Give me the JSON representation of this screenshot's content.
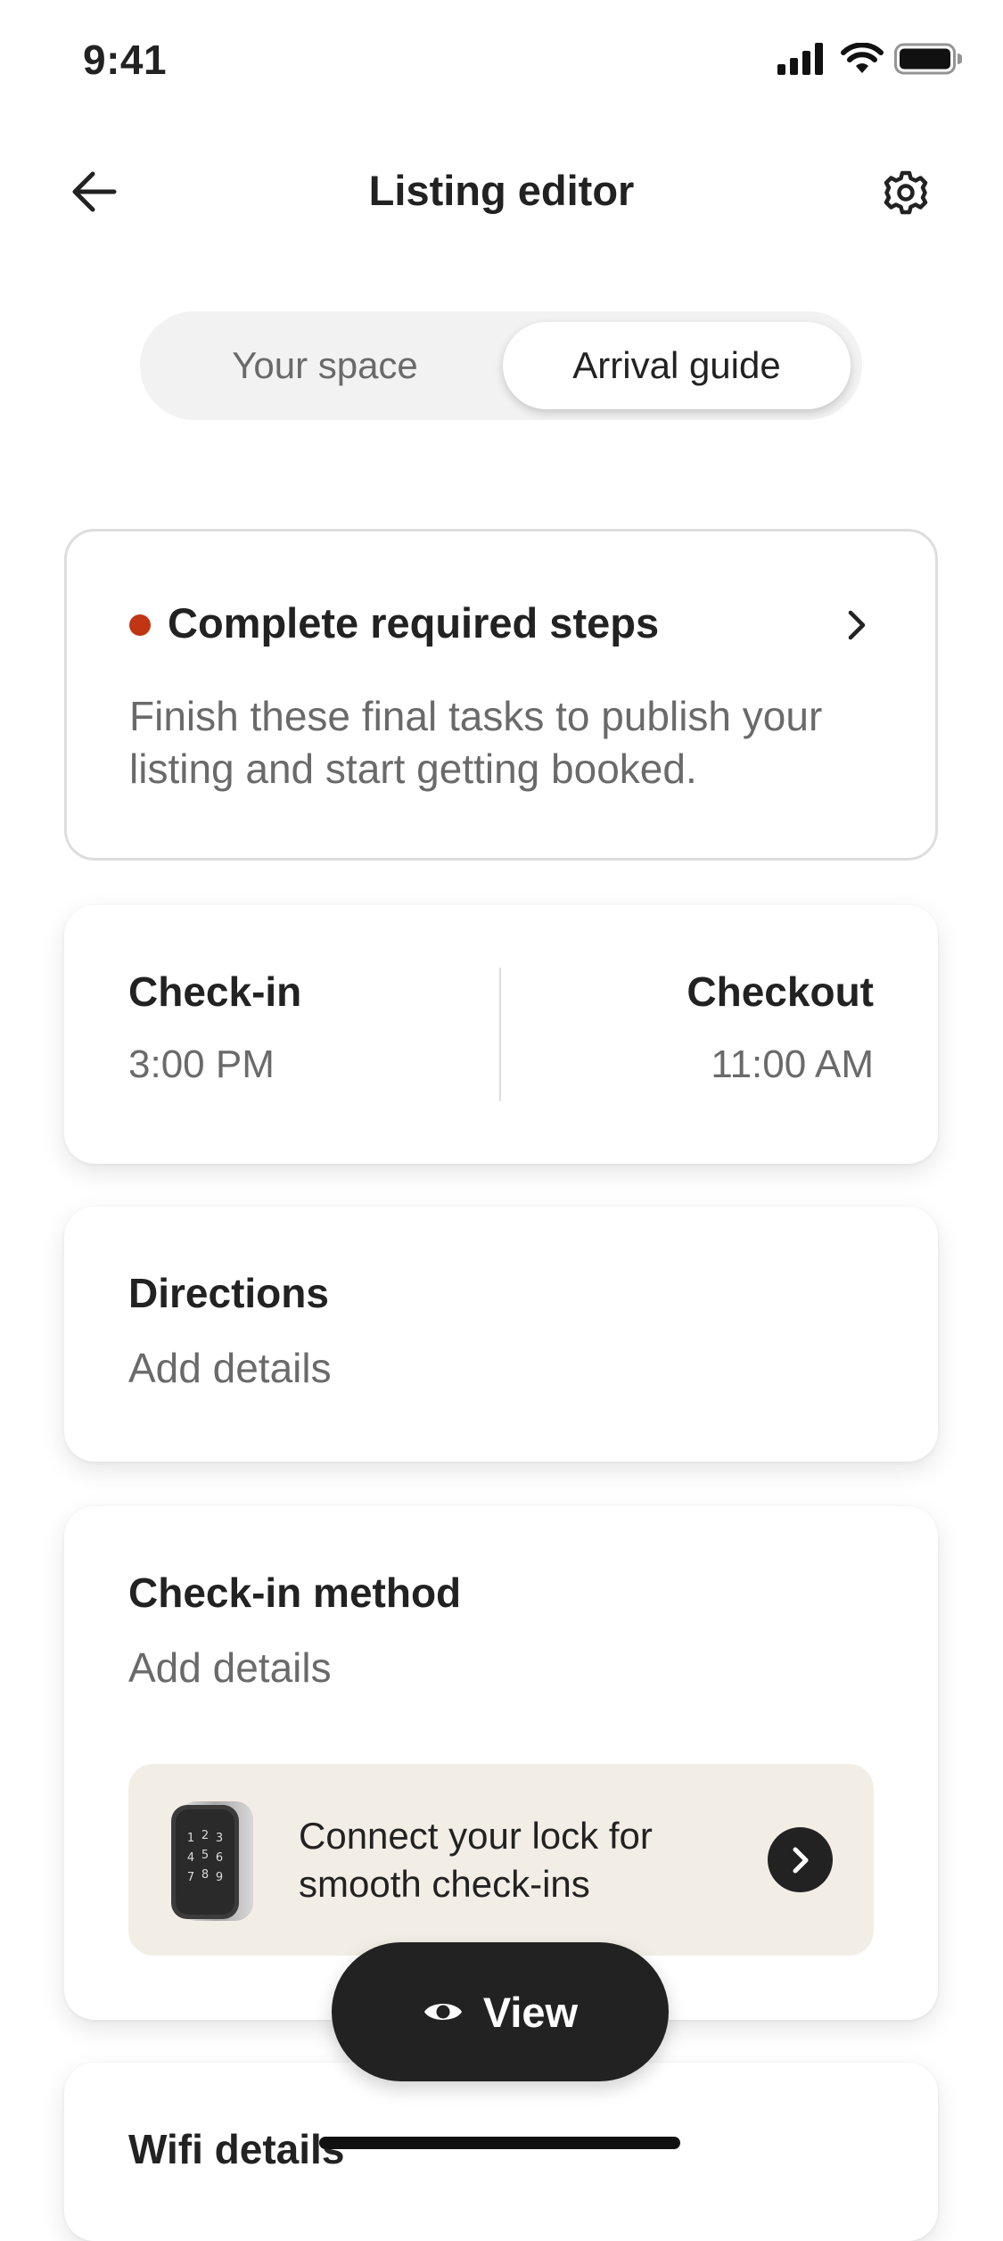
{
  "status_bar": {
    "time": "9:41"
  },
  "header": {
    "title": "Listing editor",
    "back_icon": "arrow-left-icon",
    "settings_icon": "gear-icon"
  },
  "tabs": [
    {
      "label": "Your space",
      "selected": false
    },
    {
      "label": "Arrival guide",
      "selected": true
    }
  ],
  "required_steps": {
    "title": "Complete required steps",
    "description": "Finish these final tasks to publish your listing and start getting booked.",
    "status_color": "#c13515"
  },
  "check_times": {
    "checkin_label": "Check-in",
    "checkin_value": "3:00 PM",
    "checkout_label": "Checkout",
    "checkout_value": "11:00 AM"
  },
  "directions": {
    "title": "Directions",
    "subtitle": "Add details"
  },
  "checkin_method": {
    "title": "Check-in method",
    "subtitle": "Add details",
    "promo_text": "Connect your lock for smooth check-ins",
    "promo_icon": "smart-lock-icon"
  },
  "wifi": {
    "title": "Wifi details"
  },
  "view_button": {
    "label": "View",
    "icon": "eye-icon"
  },
  "colors": {
    "accent_dot": "#c13515",
    "primary_text": "#222222",
    "secondary_text": "#6a6a6a",
    "banner_bg": "#f2eee6",
    "button_bg": "#222222"
  }
}
